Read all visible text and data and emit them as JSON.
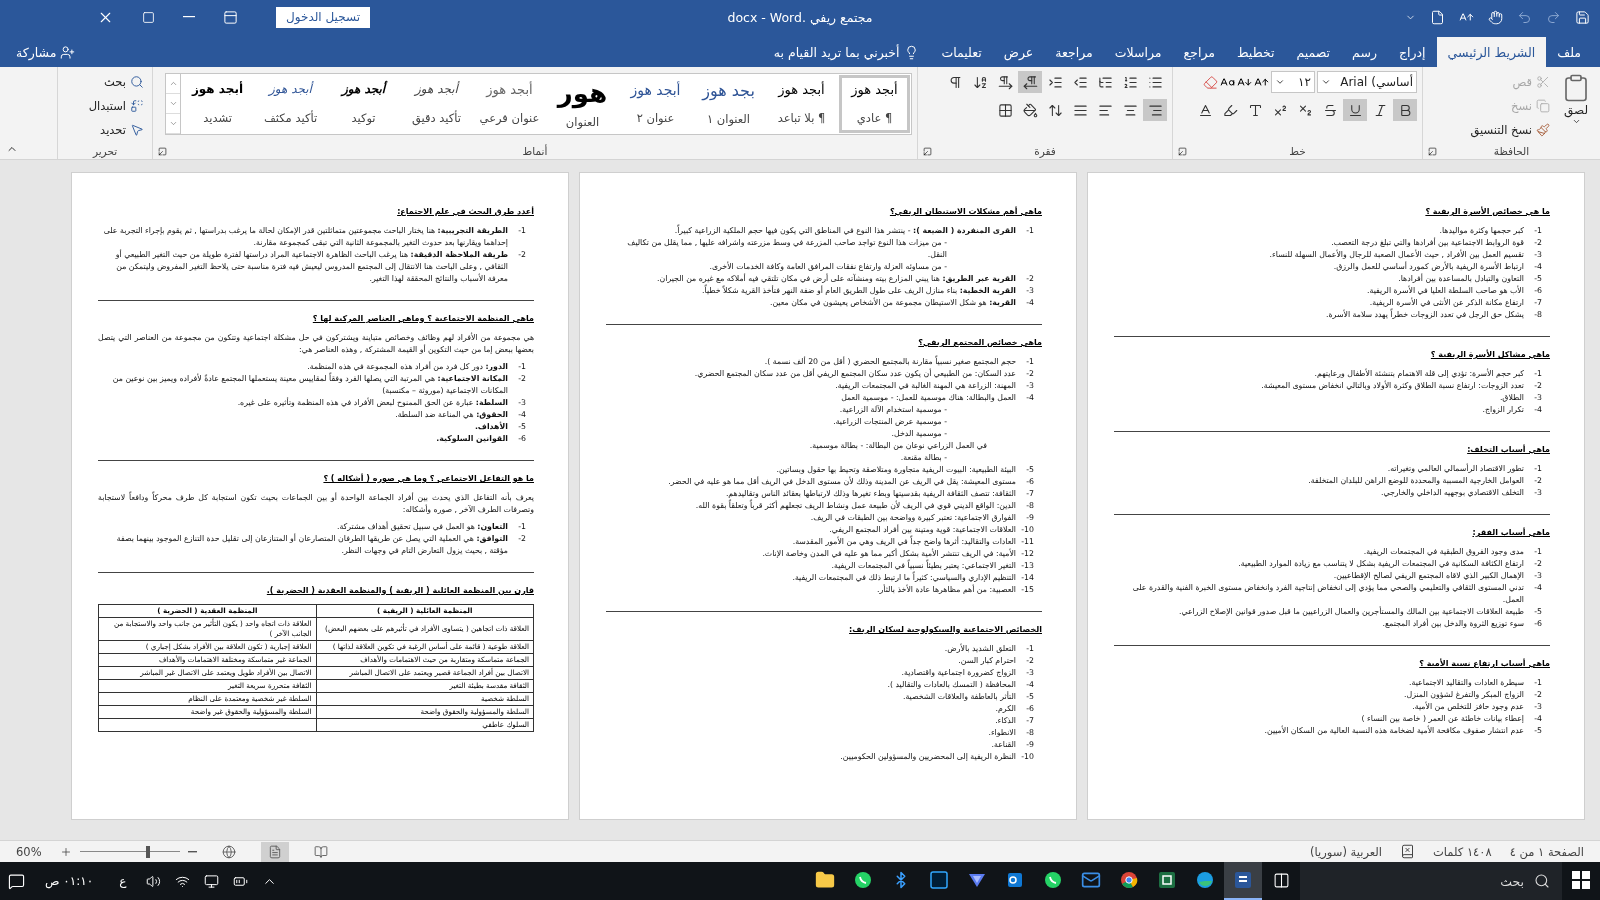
{
  "window": {
    "title": "مجتمع ريفي .docx - Word",
    "sign_in": "تسجيل الدخول"
  },
  "tabs": [
    {
      "label": "ملف",
      "selected": false
    },
    {
      "label": "الشريط الرئيسي",
      "selected": true
    },
    {
      "label": "إدراج",
      "selected": false
    },
    {
      "label": "رسم",
      "selected": false
    },
    {
      "label": "تصميم",
      "selected": false
    },
    {
      "label": "تخطيط",
      "selected": false
    },
    {
      "label": "مراجع",
      "selected": false
    },
    {
      "label": "مراسلات",
      "selected": false
    },
    {
      "label": "مراجعة",
      "selected": false
    },
    {
      "label": "عرض",
      "selected": false
    },
    {
      "label": "تعليمات",
      "selected": false
    }
  ],
  "tell_me": {
    "placeholder": "أخبرني بما تريد القيام به"
  },
  "share": "مشاركة",
  "ribbon": {
    "clipboard": {
      "label": "الحافظة",
      "paste": "لصق",
      "commands": [
        {
          "kind": "cut",
          "label": "قص",
          "disabled": true
        },
        {
          "kind": "copy",
          "label": "نسخ",
          "disabled": true
        },
        {
          "kind": "format_painter",
          "label": "نسخ التنسيق",
          "disabled": false
        }
      ]
    },
    "font": {
      "label": "خط",
      "font_name": "أساسي) Arial",
      "font_size": "١٢",
      "tools": [
        {
          "kind": "bold",
          "active": true
        },
        {
          "kind": "italic",
          "active": false
        },
        {
          "kind": "underline",
          "active": true
        },
        {
          "kind": "strike",
          "active": false
        },
        {
          "kind": "subscript",
          "active": false
        },
        {
          "kind": "superscript",
          "active": false
        },
        {
          "kind": "effects",
          "active": false
        },
        {
          "kind": "highlight",
          "active": false
        },
        {
          "kind": "color",
          "active": false
        }
      ]
    },
    "paragraph": {
      "label": "فقرة",
      "row1": [
        {
          "kind": "bullets",
          "active": false
        },
        {
          "kind": "numbering",
          "active": false
        },
        {
          "kind": "multilevel",
          "active": false
        },
        {
          "kind": "outdent",
          "active": false
        },
        {
          "kind": "indent",
          "active": false
        },
        {
          "kind": "rtl",
          "active": true
        },
        {
          "kind": "ltr",
          "active": false
        },
        {
          "kind": "sort",
          "active": false
        },
        {
          "kind": "marks",
          "active": false
        }
      ],
      "row2": [
        {
          "kind": "align_right",
          "active": true
        },
        {
          "kind": "align_center",
          "active": false
        },
        {
          "kind": "align_left",
          "active": false
        },
        {
          "kind": "justify",
          "active": false
        },
        {
          "kind": "spacing",
          "active": false
        },
        {
          "kind": "shading",
          "active": false
        },
        {
          "kind": "borders",
          "active": false
        }
      ]
    },
    "styles": {
      "label": "أنماط",
      "items": [
        {
          "kind": "normal",
          "preview": "أبجد هوز",
          "name": "¶ عادي",
          "selected": true
        },
        {
          "kind": "normal",
          "preview": "أبجد هوز",
          "name": "¶ بلا تباعد",
          "selected": false
        },
        {
          "kind": "heading",
          "preview": "بجد هوز",
          "name": "العنوان ١",
          "selected": false
        },
        {
          "kind": "heading2",
          "preview": "أبجد هوز",
          "name": "عنوان ٢",
          "selected": false
        },
        {
          "kind": "title",
          "preview": "هور",
          "name": "العنوان",
          "selected": false
        },
        {
          "kind": "subtle",
          "preview": "أبجد هوز",
          "name": "عنوان فرعي",
          "selected": false
        },
        {
          "kind": "emphasis",
          "preview": "أبجد هوز",
          "name": "تأكيد دقيق",
          "selected": false
        },
        {
          "kind": "strong_emphasis",
          "preview": "أبجد هوز",
          "name": "توكيد",
          "selected": false
        },
        {
          "kind": "intense",
          "preview": "أبجد هوز",
          "name": "تأكيد مكثف",
          "selected": false
        },
        {
          "kind": "strong",
          "preview": "أبجد هوز",
          "name": "تشديد",
          "selected": false
        }
      ]
    },
    "editing": {
      "label": "تحرير",
      "commands": [
        {
          "kind": "find",
          "label": "بحث"
        },
        {
          "kind": "replace",
          "label": "استبدال"
        },
        {
          "kind": "select",
          "label": "تحديد"
        }
      ]
    }
  },
  "pages": [
    {
      "sections": [
        {
          "heading": "ما هي خصائص الأسرة الريفية ؟",
          "lines": [
            {
              "kind": "item",
              "num": "1-",
              "text": "كبر حجمها وكثرة مواليدها."
            },
            {
              "kind": "item",
              "num": "2-",
              "text": "قوة الروابط الاجتماعية بين أفرادها والتي تبلغ درجة التعصب."
            },
            {
              "kind": "item",
              "num": "3-",
              "text": "تقسيم العمل بين الأفراد , حيث الأعمال الصعبة للرجال والأعمال السهلة للنساء."
            },
            {
              "kind": "item",
              "num": "4-",
              "text": "ارتباط الأسرة الريفية بالأرض كمورد أساسي للعمل والرزق."
            },
            {
              "kind": "item",
              "num": "5-",
              "text": "التعاون والتبادل بالمساعدة بين أفرادها."
            },
            {
              "kind": "item",
              "num": "6-",
              "text": "الأب هو صاحب السلطة العليا في الأسرة الريفية."
            },
            {
              "kind": "item",
              "num": "7-",
              "text": "ارتفاع مكانة الذكر عن الأنثى في الأسرة الريفية."
            },
            {
              "kind": "item",
              "num": "8-",
              "text": "يشكل حق الرجل في تعدد الزوجات خطراً يهدد سلامة الأسرة."
            }
          ]
        },
        {
          "heading": "ماهي مشاكل الأسرة الريفية ؟",
          "lines": [
            {
              "kind": "item",
              "num": "1-",
              "text": "كبر حجم الأسرة: تؤدي إلى قلة الاهتمام بتنشئة الأطفال ورعايتهم."
            },
            {
              "kind": "item",
              "num": "2-",
              "text": "تعدد الزوجات: ارتفاع نسبة الطلاق وكثرة الأولاد وبالتالي انخفاض مستوى المعيشة."
            },
            {
              "kind": "item",
              "num": "3-",
              "text": "الطلاق."
            },
            {
              "kind": "item",
              "num": "4-",
              "text": "تكرار الزواج."
            }
          ]
        },
        {
          "heading": "ماهي أسباب التخلف:",
          "lines": [
            {
              "kind": "item",
              "num": "1-",
              "text": "تطور الاقتصاد الرأسمالي العالمي وتغيراته."
            },
            {
              "kind": "item",
              "num": "2-",
              "text": "العوامل الخارجية المسببة والمحددة للوضع الراهن للبلدان المتخلفة."
            },
            {
              "kind": "item",
              "num": "3-",
              "text": "التخلف الاقتصادي بوجهيه الداخلي والخارجي."
            }
          ]
        },
        {
          "heading": "ماهي أسباب الفقر:",
          "lines": [
            {
              "kind": "item",
              "num": "1-",
              "text": "مدى وجود الفروق الطبقية في المجتمعات الريفية."
            },
            {
              "kind": "item",
              "num": "2-",
              "text": "ارتفاع الكثافة السكانية في المجتمعات الريفية بشكل لا يتناسب مع زيادة الموارد الطبيعية."
            },
            {
              "kind": "item",
              "num": "3-",
              "text": "الإهمال الكبير الذي لاقاه المجتمع الريفي لصالح الإقطاعيين."
            },
            {
              "kind": "item",
              "num": "4-",
              "text": "تدني المستوى الثقافي والتعليمي والصحي مما يؤدي إلى انخفاض إنتاجية الفرد وانخفاض مستوى الخبرة الفنية والقدرة على العمل."
            },
            {
              "kind": "item",
              "num": "5-",
              "text": "طبيعة العلاقات الاجتماعية بين المالك والمستأجرين والعمال الزراعيين ما قبل صدور قوانين الإصلاح الزراعي."
            },
            {
              "kind": "item",
              "num": "6-",
              "text": "سوء توزيع الثروة والدخل بين أفراد المجتمع."
            }
          ]
        },
        {
          "heading": "ماهي أسباب ارتفاع نسبة الأمية ؟",
          "lines": [
            {
              "kind": "item",
              "num": "1-",
              "text": "سيطرة العادات والتقاليد الاجتماعية."
            },
            {
              "kind": "item",
              "num": "2-",
              "text": "الزواج المبكر والتفرغ لشؤون المنزل."
            },
            {
              "kind": "item",
              "num": "3-",
              "text": "عدم وجود حافز للتخلص من الأمية."
            },
            {
              "kind": "item",
              "num": "4-",
              "text": "إعطاء بيانات خاطئة عن العمر ( خاصة بين النساء )"
            },
            {
              "kind": "item",
              "num": "5-",
              "text": "عدم انتشار صفوف مكافحة الأمية لضخامة هذه النسبة العالية من السكان الأميين."
            }
          ]
        }
      ]
    },
    {
      "sections": [
        {
          "heading": "ماهي أهم مشكلات الاستيطان الريفي؟",
          "lines": [
            {
              "kind": "item",
              "num": "1-",
              "term": "القرى المنفردة ( الضيعة ):",
              "text": " - ينتشر هذا النوع في المناطق التي يكون فيها حجم الملكية الزراعية كبيراً."
            },
            {
              "kind": "sub",
              "text": "- من ميزات هذا النوع تواجد صاحب المزرعة في وسط مزرعته واشرافه عليها , مما يقلل من تكاليف النقل."
            },
            {
              "kind": "sub",
              "text": "- من مساوئه العزلة وارتفاع نفقات المرافق العامة وكافة الخدمات الأخرى."
            },
            {
              "kind": "item",
              "num": "2-",
              "term": "القرية عبر الطريق:",
              "text": " هنا يبني المزارع بيته ومنشآته على أرض في مكان تلتقي فيه أملاكه مع غيره من الجيران."
            },
            {
              "kind": "item",
              "num": "3-",
              "term": "القرية الخطية:",
              "text": " بناء منازل الريف على طول الطريق العام أو ضفة النهر فتأخذ القرية شكلاً خطياً."
            },
            {
              "kind": "item",
              "num": "4-",
              "term": "القرية:",
              "text": " هو شكل الاستيطان مجموعة من الأشخاص يعيشون في مكان معين."
            }
          ]
        },
        {
          "heading": "ماهي خصائص المجتمع الريفي؟",
          "lines": [
            {
              "kind": "item",
              "num": "1-",
              "text": "حجم المجتمع صغير نسبياً مقارنة بالمجتمع الحضري ( أقل من 20 ألف نسمة )."
            },
            {
              "kind": "item",
              "num": "2-",
              "text": "عدد السكان: من الطبيعي أن يكون عدد سكان المجتمع الريفي أقل من عدد سكان المجتمع الحضري."
            },
            {
              "kind": "item",
              "num": "3-",
              "text": "المهنة: الزراعة هي المهنة الغالبة في المجتمعات الريفية."
            },
            {
              "kind": "item",
              "num": "4-",
              "text": "العمل والبطالة: هناك موسمية للعمل: - موسمية العمل"
            },
            {
              "kind": "sub",
              "text": "- موسمية استخدام الآلة الزراعية."
            },
            {
              "kind": "sub",
              "text": "- موسمية عرض المنتجات الزراعية."
            },
            {
              "kind": "sub",
              "text": "- موسمية الدخل."
            },
            {
              "kind": "note",
              "text": "في العمل الزراعي نوعان من البطالة: - بطالة موسمية."
            },
            {
              "kind": "sub",
              "text": "- بطالة مقنعة."
            },
            {
              "kind": "item",
              "num": "5-",
              "text": "البيئة الطبيعية: البيوت الريفية متجاورة ومتلاصقة وتحيط بها حقول وبساتين."
            },
            {
              "kind": "item",
              "num": "6-",
              "text": "مستوى المعيشة: يقل في الريف عن المدينة وذلك لأن مستوى الدخل في الريف أقل مما هو عليه في الحضر."
            },
            {
              "kind": "item",
              "num": "7-",
              "text": "الثقافة: تتصف الثقافة الريفية بقدسيتها وبطء تغيرها وذلك لارتباطها بعقائد الناس وتقاليدهم."
            },
            {
              "kind": "item",
              "num": "8-",
              "text": "الدين: الواقع الديني قوي في الريف لأن طبيعة عمل ونشاط الريف تجعلهم أكثر قرباً وتعلقاً بقوة الله."
            },
            {
              "kind": "item",
              "num": "9-",
              "text": "الفوارق الاجتماعية: تعتبر كبيرة وواضحة بين الطبقات في الريف."
            },
            {
              "kind": "item",
              "num": "10-",
              "text": "العلاقات الاجتماعية: قوية ومتينة بين أفراد المجتمع الريفي."
            },
            {
              "kind": "item",
              "num": "11-",
              "text": "العادات والتقاليد: أثرها واضح جداً في الريف وهي من الأمور المقدسة."
            },
            {
              "kind": "item",
              "num": "12-",
              "text": "الأمية: في الريف تنتشر الأمية بشكل أكبر مما هو عليه في المدن وخاصة الإناث."
            },
            {
              "kind": "item",
              "num": "13-",
              "text": "التغير الاجتماعي: يعتبر بطيئاً نسبياً في المجتمعات الريفية."
            },
            {
              "kind": "item",
              "num": "14-",
              "text": "التنظيم الإداري والسياسي: كثيراً ما ارتبط ذلك في المجتمعات الريفية."
            },
            {
              "kind": "item",
              "num": "15-",
              "text": "العصبية: من أهم مظاهرها عادة الأخذ بالثأر."
            }
          ]
        },
        {
          "heading": "الخصائص الاجتماعية والسيكولوجية لسكان الريف:",
          "lines": [
            {
              "kind": "item",
              "num": "1-",
              "text": "التعلق الشديد بالأرض."
            },
            {
              "kind": "item",
              "num": "2-",
              "text": "احترام كبار السن."
            },
            {
              "kind": "item",
              "num": "3-",
              "text": "الزواج كضرورة اجتماعية واقتصادية."
            },
            {
              "kind": "item",
              "num": "4-",
              "text": "المحافظة ( التمسك بالعادات والتقاليد )."
            },
            {
              "kind": "item",
              "num": "5-",
              "text": "التأثر بالعاطفة والعلاقات الشخصية."
            },
            {
              "kind": "item",
              "num": "6-",
              "text": "الكرم."
            },
            {
              "kind": "item",
              "num": "7-",
              "text": "الذكاء."
            },
            {
              "kind": "item",
              "num": "8-",
              "text": "الانطواء."
            },
            {
              "kind": "item",
              "num": "9-",
              "text": "القناعة."
            },
            {
              "kind": "item",
              "num": "10-",
              "text": "النظرة الريفية إلى المحضريين والمسؤولين الحكوميين."
            }
          ]
        }
      ]
    },
    {
      "sections": [
        {
          "heading": "أعدد طرق البحث في علم الاجتماع:",
          "lines": [
            {
              "kind": "item",
              "num": "1-",
              "term": "الطريقة التجريبية:",
              "text": " هنا يختار الباحث مجموعتين متماثلتين قدر الإمكان لحالة ما يرغب بدراستها , ثم يقوم بإجراء التجربة على إحداهما ويقارنها بعد حدوث التغير بالمجموعة الثانية التي تبقى كمجموعة مقارنة."
            },
            {
              "kind": "item",
              "num": "2-",
              "term": "طريقة الملاحظة الدقيقة:",
              "text": " هنا يرغب الباحث الظاهرة الاجتماعية المراد دراستها لفترة طويلة من حيث التغير الطبيعي أو الثقافي , وعلى الباحث هنا الانتقال إلى المجتمع المدروس ليعيش فيه فترة مناسبة حتى يلاحظ التغير المفروض وليتمكن من معرفة الأسباب والنتائج المحققة لهذا التغير."
            }
          ]
        },
        {
          "heading": "ماهي المنظمة الاجتماعية ؟ وماهي العناصر المركبة لها ؟",
          "intro": "هي مجموعة من الأفراد لهم وظائف وخصائص متباينة ويشتركون في حل مشكلة اجتماعية وتتكون من مجموعة من العناصر التي يتصل بعضها ببعض إما من حيث التكوين أو القيمة المشتركة , وهذه العناصر هي:",
          "lines": [
            {
              "kind": "item",
              "num": "1-",
              "term": "الدور:",
              "text": " دور كل فرد من أفراد هذه المجموعة في هذه المنظمة."
            },
            {
              "kind": "item",
              "num": "2-",
              "term": "المكانة الاجتماعية:",
              "text": " هي المرتبة التي يصلها الفرد وفقاً لمقاييس معينة يستعملها المجتمع عادةً لأفراده ويميز بين نوعين من المكانات الاجتماعية (موروثة – مكتسبة)"
            },
            {
              "kind": "item",
              "num": "3-",
              "term": "السلطة:",
              "text": " عبارة عن الحق الممنوح لبعض الأفراد في هذه المنظمة وتأثيره على غيره."
            },
            {
              "kind": "item",
              "num": "4-",
              "term": "الحقوق:",
              "text": " هي المناعة ضد السلطة."
            },
            {
              "kind": "item",
              "num": "5-",
              "term": "الأهداف."
            },
            {
              "kind": "item",
              "num": "6-",
              "term": "القوانين السلوكية."
            }
          ]
        },
        {
          "heading": "ما هو التفاعل الاجتماعي ؟ وما هي صوره ( أشكاله ) ؟",
          "intro": "يعرف بأنه التفاعل الذي يحدث بين أفراد الجماعة الواحدة أو بين الجماعات بحيث تكون استجابة كل طرف محركاً ودافعاً لاستجابة وتصرفات الطرف الآخر , صوره وأشكاله:",
          "lines": [
            {
              "kind": "item",
              "num": "1-",
              "term": "التعاون:",
              "text": " هو العمل في سبيل تحقيق أهداف مشتركة."
            },
            {
              "kind": "item",
              "num": "2-",
              "term": "التوافق:",
              "text": " هي العملية التي يصل عن طريقها الطرفان المتصارعان أو المتنازعان إلى تقليل حدة التنازع الموجود بينهما بصفة مؤقتة , بحيث يزول التعارض التام في وجهات النظر."
            }
          ]
        },
        {
          "heading": "قارن بين المنظمة العائلية ( الريفية ) والمنظمة العقدية ( الحضرية ).",
          "table": {
            "columns": [
              "المنظمة العائلية ( الريفية )",
              "المنظمة العقدية ( الحضرية )"
            ],
            "rows": [
              [
                "العلاقة ذات اتجاهين ( يتساوى الأفراد في تأثيرهم على بعضهم البعض)",
                "العلاقة ذات اتجاه واحد ( يكون التأثير من جانب واحد والاستجابة من الجانب الآخر )"
              ],
              [
                "العلاقة طوعية ( قائمة على أساس الرغبة في تكوين العلاقة لذاتها )",
                "العلاقة إجبارية ( تكون العلاقة بين الأفراد بشكل إجباري )"
              ],
              [
                "الجماعة متماسكة ومتقاربة من حيث الاهتمامات والأهداف",
                "الجماعة غير متماسكة ومختلفة الاهتمامات والأهداف"
              ],
              [
                "الاتصال بين أفراد الجماعة قصير ويعتمد على الاتصال المباشر",
                "الاتصال بين الأفراد طويل ويعتمد على الاتصال غير المباشر"
              ],
              [
                "الثقافة مقدسة بطيئة التغير",
                "الثقافة متحررة سريعة التغير"
              ],
              [
                "السلطة شخصية",
                "السلطة غير شخصية ومعتمدة على النظام"
              ],
              [
                "السلطة والمسؤولية والحقوق واضحة",
                "السلطة والمسؤولية والحقوق غير واضحة"
              ],
              [
                "السلوك عاطفي",
                null
              ]
            ]
          }
        }
      ]
    }
  ],
  "status_bar": {
    "page": "الصفحة ١ من ٤",
    "words": "١٤٠٨ كلمات",
    "language": "العربية (سوريا)",
    "views": [
      {
        "kind": "read",
        "selected": false
      },
      {
        "kind": "print",
        "selected": true
      },
      {
        "kind": "web",
        "selected": false
      }
    ],
    "zoom": {
      "label": "60%",
      "level": 0.68
    }
  },
  "taskbar": {
    "search": "بحث",
    "apps": [
      {
        "kind": "word",
        "selected": true
      },
      {
        "kind": "edge",
        "selected": false
      },
      {
        "kind": "excel",
        "selected": false
      },
      {
        "kind": "chrome",
        "selected": false
      },
      {
        "kind": "mail",
        "selected": false
      },
      {
        "kind": "whatsapp",
        "selected": false
      },
      {
        "kind": "outlook",
        "selected": false
      },
      {
        "kind": "vpn",
        "selected": false
      },
      {
        "kind": "photoshop",
        "selected": false
      },
      {
        "kind": "bluetooth",
        "selected": false
      },
      {
        "kind": "whatsapp",
        "selected": false
      },
      {
        "kind": "explorer",
        "selected": false
      }
    ],
    "language": "ع",
    "time": "٠١:١٠ ص"
  }
}
